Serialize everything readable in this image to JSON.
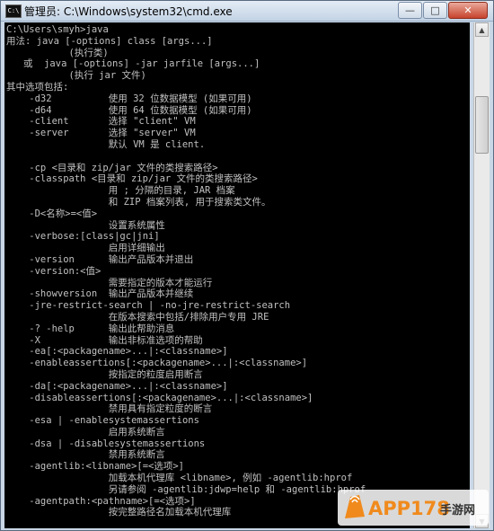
{
  "window": {
    "icon_text": "C:\\",
    "title": "管理员: C:\\Windows\\system32\\cmd.exe",
    "minimize_glyph": "—",
    "maximize_glyph": "□",
    "close_glyph": "✕"
  },
  "console": {
    "lines": [
      "C:\\Users\\smyh>java",
      "用法: java [-options] class [args...]",
      "           (执行类)",
      "   或  java [-options] -jar jarfile [args...]",
      "           (执行 jar 文件)",
      "其中选项包括:",
      "    -d32          使用 32 位数据模型 (如果可用)",
      "    -d64          使用 64 位数据模型 (如果可用)",
      "    -client       选择 \"client\" VM",
      "    -server       选择 \"server\" VM",
      "                  默认 VM 是 client.",
      "",
      "    -cp <目录和 zip/jar 文件的类搜索路径>",
      "    -classpath <目录和 zip/jar 文件的类搜索路径>",
      "                  用 ; 分隔的目录, JAR 档案",
      "                  和 ZIP 档案列表, 用于搜索类文件。",
      "    -D<名称>=<值>",
      "                  设置系统属性",
      "    -verbose:[class|gc|jni]",
      "                  启用详细输出",
      "    -version      输出产品版本并退出",
      "    -version:<值>",
      "                  需要指定的版本才能运行",
      "    -showversion  输出产品版本并继续",
      "    -jre-restrict-search | -no-jre-restrict-search",
      "                  在版本搜索中包括/排除用户专用 JRE",
      "    -? -help      输出此帮助消息",
      "    -X            输出非标准选项的帮助",
      "    -ea[:<packagename>...|:<classname>]",
      "    -enableassertions[:<packagename>...|:<classname>]",
      "                  按指定的粒度启用断言",
      "    -da[:<packagename>...|:<classname>]",
      "    -disableassertions[:<packagename>...|:<classname>]",
      "                  禁用具有指定粒度的断言",
      "    -esa | -enablesystemassertions",
      "                  启用系统断言",
      "    -dsa | -disablesystemassertions",
      "                  禁用系统断言",
      "    -agentlib:<libname>[=<选项>]",
      "                  加载本机代理库 <libname>, 例如 -agentlib:hprof",
      "                  另请参阅 -agentlib:jdwp=help 和 -agentlib:hprof",
      "    -agentpath:<pathname>[=<选项>]",
      "                  按完整路径名加载本机代理库"
    ]
  },
  "watermark": {
    "brand": "APP178",
    "suffix": "手游网"
  },
  "colors": {
    "console_bg": "#000000",
    "console_fg": "#c0c0c0",
    "watermark_orange": "#f08a1c"
  }
}
